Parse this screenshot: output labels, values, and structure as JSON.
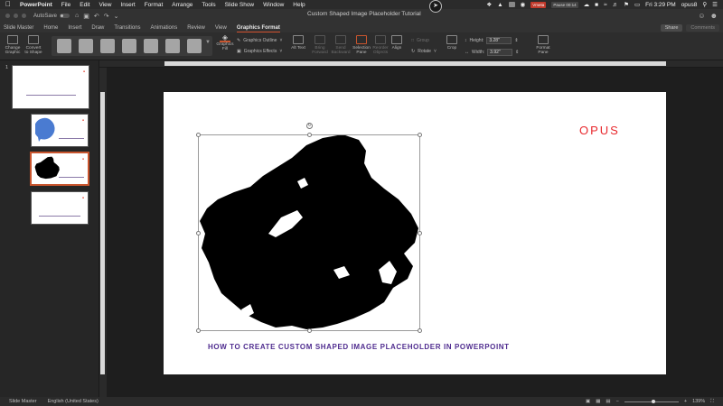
{
  "menubar": {
    "app_name": "PowerPoint",
    "items": [
      "File",
      "Edit",
      "View",
      "Insert",
      "Format",
      "Arrange",
      "Tools",
      "Slide Show",
      "Window",
      "Help"
    ],
    "badge_red": "Vmeta",
    "badge_pause": "Pause 00:14",
    "time": "Fri 3:29 PM",
    "user": "opus8"
  },
  "titlebar": {
    "autosave_label": "AutoSave",
    "autosave_state": "OFF",
    "document_title": "Custom Shaped Image Placeholder Tutorial"
  },
  "tabs": [
    {
      "label": "Slide Master"
    },
    {
      "label": "Home"
    },
    {
      "label": "Insert"
    },
    {
      "label": "Draw"
    },
    {
      "label": "Transitions"
    },
    {
      "label": "Animations"
    },
    {
      "label": "Review"
    },
    {
      "label": "View"
    },
    {
      "label": "Graphics Format",
      "active": true
    }
  ],
  "share_label": "Share",
  "comments_label": "Comments",
  "ribbon": {
    "change_graphic": "Change Graphic",
    "convert_to_shape": "Convert to Shape",
    "graphics_fill": "Graphics Fill",
    "graphics_outline": "Graphics Outline",
    "graphics_effects": "Graphics Effects",
    "alt_text": "Alt Text",
    "bring_forward": "Bring Forward",
    "send_backward": "Send Backward",
    "selection_pane": "Selection Pane",
    "reorder_objects": "Reorder Objects",
    "align": "Align",
    "group": "Group",
    "rotate": "Rotate",
    "crop": "Crop",
    "height_label": "Height:",
    "height_value": "3.28\"",
    "width_label": "Width:",
    "width_value": "3.92\"",
    "format_pane": "Format Pane",
    "style_swatch_color": "#a5a5a5",
    "accent_color": "#c9552e"
  },
  "thumbnails": [
    {
      "number": "1"
    },
    {
      "number": ""
    },
    {
      "number": ""
    },
    {
      "number": ""
    }
  ],
  "slide": {
    "logo_text": "OPUS",
    "logo_color": "#e8282d",
    "caption": "HOW TO CREATE CUSTOM SHAPED IMAGE PLACEHOLDER IN POWERPOINT",
    "caption_color": "#4f2c8f"
  },
  "statusbar": {
    "view": "Slide Master",
    "language": "English (United States)",
    "zoom": "139%"
  }
}
